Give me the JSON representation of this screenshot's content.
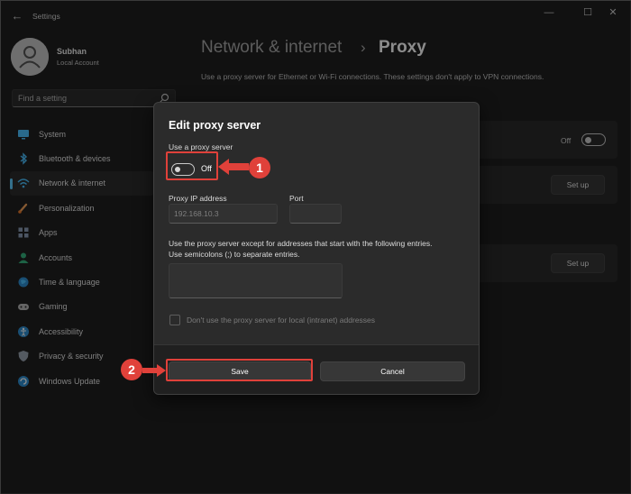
{
  "app": {
    "title": "Settings",
    "back": "←"
  },
  "window_controls": {
    "minimize": "—",
    "maximize": "☐",
    "close": "✕"
  },
  "account": {
    "name": "Subhan",
    "type": "Local Account"
  },
  "search": {
    "placeholder": "Find a setting",
    "icon": "search-icon"
  },
  "sidebar": {
    "items": [
      {
        "label": "System",
        "icon": "monitor-icon",
        "color": "#4cc2ff"
      },
      {
        "label": "Bluetooth & devices",
        "icon": "bluetooth-icon",
        "color": "#4cc2ff"
      },
      {
        "label": "Network & internet",
        "icon": "wifi-icon",
        "color": "#4cc2ff",
        "active": true
      },
      {
        "label": "Personalization",
        "icon": "brush-icon",
        "color": "#f3a25b"
      },
      {
        "label": "Apps",
        "icon": "apps-icon",
        "color": "#8a9bb5"
      },
      {
        "label": "Accounts",
        "icon": "person-icon",
        "color": "#36b37e"
      },
      {
        "label": "Time & language",
        "icon": "globe-icon",
        "color": "#4cc2ff"
      },
      {
        "label": "Gaming",
        "icon": "gamepad-icon",
        "color": "#b8b8b8"
      },
      {
        "label": "Accessibility",
        "icon": "accessibility-icon",
        "color": "#4cc2ff"
      },
      {
        "label": "Privacy & security",
        "icon": "shield-icon",
        "color": "#9aa4b1"
      },
      {
        "label": "Windows Update",
        "icon": "update-icon",
        "color": "#4cc2ff"
      }
    ]
  },
  "main": {
    "breadcrumb_parent": "Network & internet",
    "breadcrumb_sep": "›",
    "breadcrumb_current": "Proxy",
    "description": "Use a proxy server for Ethernet or Wi-Fi connections. These settings don't apply to VPN connections.",
    "bg_toggle_state": "Off",
    "setup_label_1": "Set up",
    "setup_label_2": "Set up"
  },
  "dialog": {
    "title": "Edit proxy server",
    "use_proxy_label": "Use a proxy server",
    "toggle_state": "Off",
    "ip_label": "Proxy IP address",
    "ip_placeholder": "192.168.10.3",
    "port_label": "Port",
    "exceptions_text_1": "Use the proxy server except for addresses that start with the following entries.",
    "exceptions_text_2": "Use semicolons (;) to separate entries.",
    "local_checkbox_label": "Don't use the proxy server for local (intranet) addresses",
    "save_label": "Save",
    "cancel_label": "Cancel"
  },
  "annotations": {
    "marker_1": "1",
    "marker_2": "2",
    "color": "#e0413a"
  }
}
